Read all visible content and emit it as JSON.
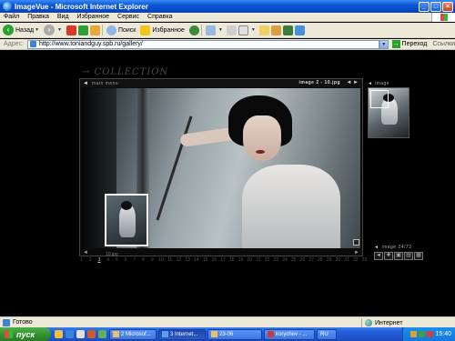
{
  "window": {
    "title": "ImageVue - Microsoft Internet Explorer"
  },
  "menu": [
    "Файл",
    "Правка",
    "Вид",
    "Избранное",
    "Сервис",
    "Справка"
  ],
  "toolbar": {
    "back": "Назад",
    "search": "Поиск",
    "favorites": "Избранное"
  },
  "address": {
    "label": "Адрес:",
    "url": "http://www.toniandguy.spb.ru/gallery/",
    "go": "Переход",
    "links": "Ссылки"
  },
  "gallery": {
    "heading": "COLLECTION",
    "main_menu": "main menu",
    "image_counter": "image 2 - 10.jpg",
    "side_label": "image",
    "side_count": "image 24/72",
    "caption": "10.jpg",
    "pages": [
      "1",
      "2",
      "3",
      "4",
      "5",
      "6",
      "7",
      "8",
      "9",
      "10",
      "11",
      "12",
      "13",
      "14",
      "15",
      "16",
      "17",
      "18",
      "19",
      "20",
      "21",
      "22",
      "23",
      "24",
      "25",
      "26",
      "27",
      "28",
      "29",
      "30",
      "31",
      "32",
      "33"
    ],
    "current_page": "3",
    "tools": [
      "◄",
      "✚",
      "▣",
      "▤",
      "▦"
    ]
  },
  "status": {
    "text": "Готово",
    "zone": "Интернет"
  },
  "taskbar": {
    "start": "пуск",
    "tasks": [
      {
        "label": "2 Microsof..."
      },
      {
        "label": "3 Internet..."
      },
      {
        "label": "23-06"
      },
      {
        "label": "korychev - ..."
      },
      {
        "label": "RU"
      }
    ],
    "clock": "15:40"
  }
}
